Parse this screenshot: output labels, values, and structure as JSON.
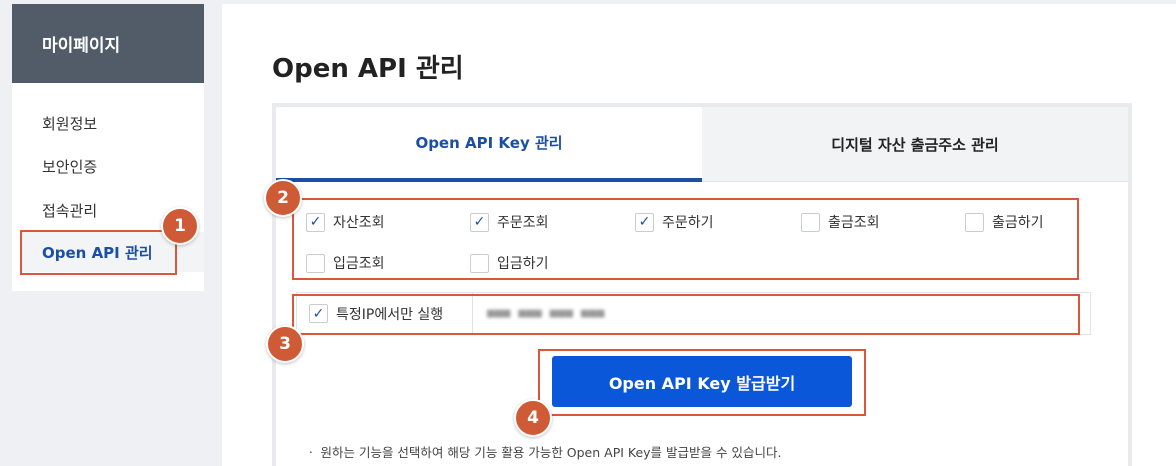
{
  "sidebar": {
    "title": "마이페이지",
    "items": [
      {
        "label": "회원정보"
      },
      {
        "label": "보안인증"
      },
      {
        "label": "접속관리"
      },
      {
        "label": "Open API 관리"
      }
    ]
  },
  "main": {
    "title": "Open API 관리",
    "tabs": [
      {
        "label": "Open API Key 관리",
        "active": true
      },
      {
        "label": "디지털 자산 출금주소 관리",
        "active": false
      }
    ],
    "permissions": [
      {
        "label": "자산조회",
        "checked": true
      },
      {
        "label": "주문조회",
        "checked": true
      },
      {
        "label": "주문하기",
        "checked": true
      },
      {
        "label": "출금조회",
        "checked": false
      },
      {
        "label": "출금하기",
        "checked": false
      },
      {
        "label": "입금조회",
        "checked": false
      },
      {
        "label": "입금하기",
        "checked": false
      }
    ],
    "ip_restriction": {
      "label": "특정IP에서만 실행",
      "checked": true,
      "value": "■■■ ■■■ ■■■ ■■■"
    },
    "issue_button": "Open API Key 발급받기",
    "note": "ㆍ 원하는 기능을 선택하여 해당 기능 활용 가능한 Open API Key를 발급받을 수 있습니다."
  },
  "annotations": [
    "1",
    "2",
    "3",
    "4"
  ],
  "colors": {
    "accent": "#1b4fa3",
    "button": "#0b57d9",
    "annotation": "#cf5a36",
    "sidebar_header": "#525c68"
  }
}
